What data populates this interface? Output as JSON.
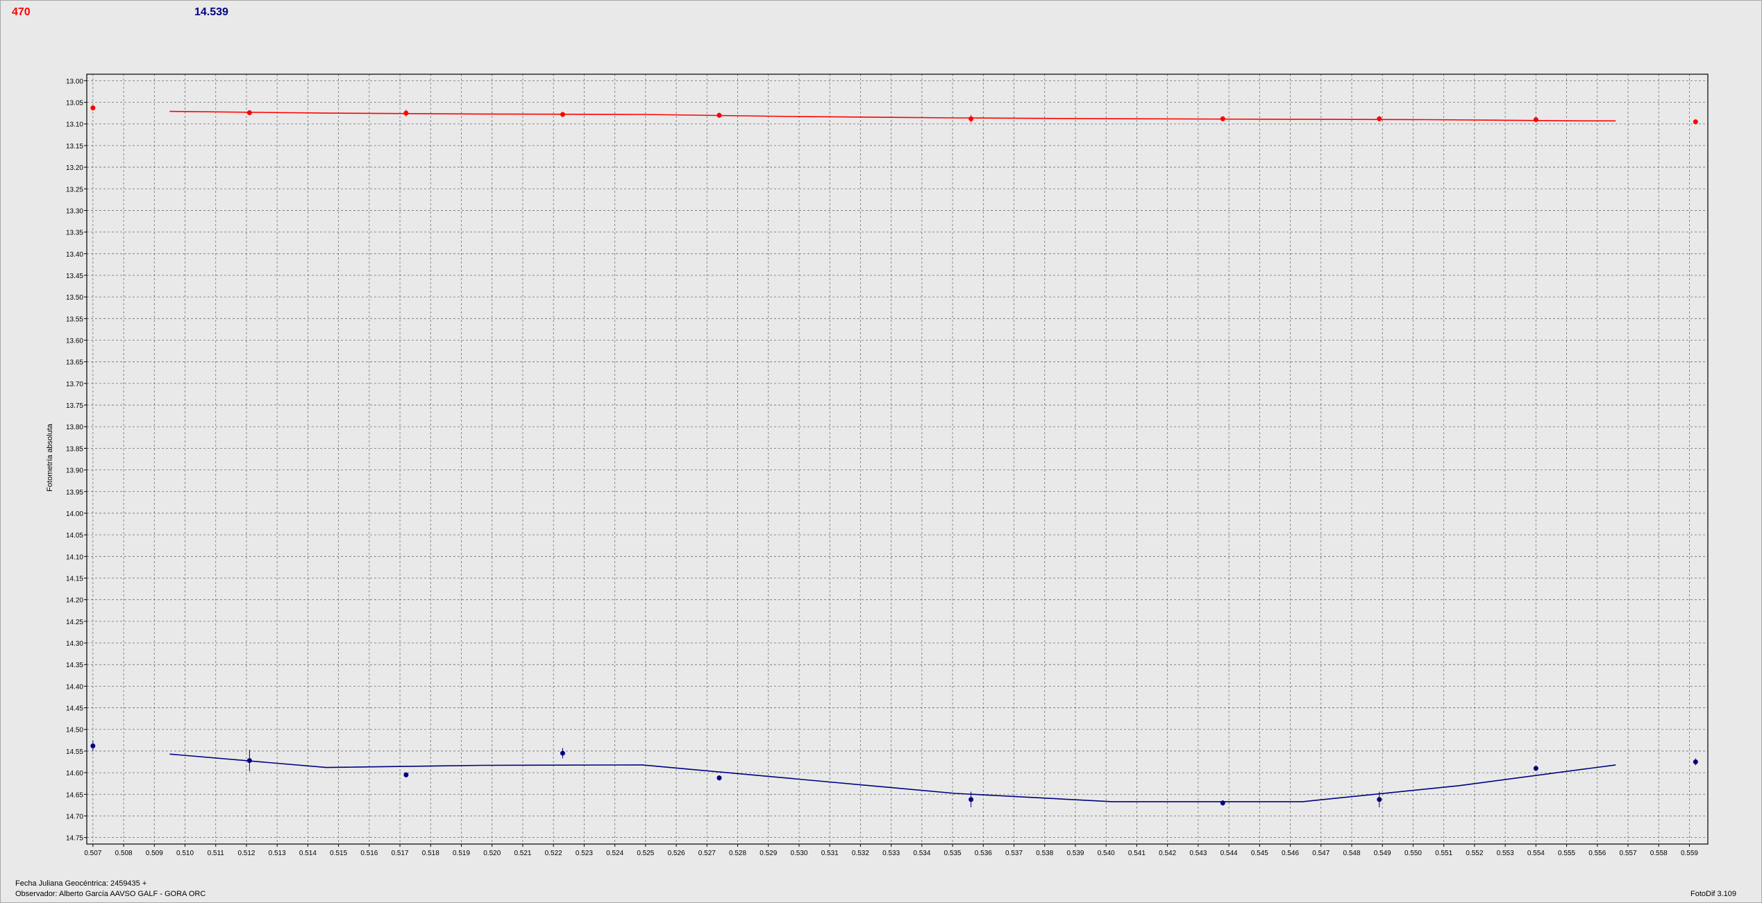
{
  "header": {
    "left_value": "470",
    "left_color": "#ff0000",
    "right_value": "14.539",
    "right_color": "#000080"
  },
  "footer": {
    "jd": "Fecha Juliana Geocéntrica: 2459435 +",
    "observer": "Observador: Alberto García AAVSO GALF - GORA ORC",
    "version": "FotoDif 3.109"
  },
  "chart_data": {
    "type": "scatter",
    "title": "",
    "xlabel": "",
    "ylabel": "Fotometría absoluta",
    "xlim": [
      0.5068,
      0.5596
    ],
    "ylim": [
      12.985,
      14.765
    ],
    "y_inverted": true,
    "grid": true,
    "x_ticks": [
      "0.507",
      "0.508",
      "0.509",
      "0.510",
      "0.511",
      "0.512",
      "0.513",
      "0.514",
      "0.515",
      "0.516",
      "0.517",
      "0.518",
      "0.519",
      "0.520",
      "0.521",
      "0.522",
      "0.523",
      "0.524",
      "0.525",
      "0.526",
      "0.527",
      "0.528",
      "0.529",
      "0.530",
      "0.531",
      "0.532",
      "0.533",
      "0.534",
      "0.535",
      "0.536",
      "0.537",
      "0.538",
      "0.539",
      "0.540",
      "0.541",
      "0.542",
      "0.543",
      "0.544",
      "0.545",
      "0.546",
      "0.547",
      "0.548",
      "0.549",
      "0.550",
      "0.551",
      "0.552",
      "0.553",
      "0.554",
      "0.555",
      "0.556",
      "0.557",
      "0.558",
      "0.559"
    ],
    "y_ticks": [
      "13.00",
      "13.05",
      "13.10",
      "13.15",
      "13.20",
      "13.25",
      "13.30",
      "13.35",
      "13.40",
      "13.45",
      "13.50",
      "13.55",
      "13.60",
      "13.65",
      "13.70",
      "13.75",
      "13.80",
      "13.85",
      "13.90",
      "13.95",
      "14.00",
      "14.05",
      "14.10",
      "14.15",
      "14.20",
      "14.25",
      "14.30",
      "14.35",
      "14.40",
      "14.45",
      "14.50",
      "14.55",
      "14.60",
      "14.65",
      "14.70",
      "14.75"
    ],
    "series": [
      {
        "color": "#ff0000",
        "points": [
          {
            "x": 0.507,
            "y": 13.063,
            "err": 0.006
          },
          {
            "x": 0.5121,
            "y": 13.074,
            "err": 0.006
          },
          {
            "x": 0.5172,
            "y": 13.075,
            "err": 0.008
          },
          {
            "x": 0.5223,
            "y": 13.078,
            "err": 0.006
          },
          {
            "x": 0.5274,
            "y": 13.08,
            "err": 0.006
          },
          {
            "x": 0.5356,
            "y": 13.088,
            "err": 0.009
          },
          {
            "x": 0.5438,
            "y": 13.088,
            "err": 0.006
          },
          {
            "x": 0.5489,
            "y": 13.088,
            "err": 0.006
          },
          {
            "x": 0.554,
            "y": 13.09,
            "err": 0.006
          },
          {
            "x": 0.5592,
            "y": 13.095,
            "err": 0.006
          }
        ],
        "fit": [
          {
            "x": 0.5095,
            "y": 13.071
          },
          {
            "x": 0.5146,
            "y": 13.075
          },
          {
            "x": 0.5197,
            "y": 13.077
          },
          {
            "x": 0.5249,
            "y": 13.078
          },
          {
            "x": 0.53,
            "y": 13.083
          },
          {
            "x": 0.5351,
            "y": 13.086
          },
          {
            "x": 0.5402,
            "y": 13.088
          },
          {
            "x": 0.5453,
            "y": 13.089
          },
          {
            "x": 0.5504,
            "y": 13.09
          },
          {
            "x": 0.5555,
            "y": 13.093
          },
          {
            "x": 0.5566,
            "y": 13.093
          }
        ]
      },
      {
        "color": "#000080",
        "points": [
          {
            "x": 0.507,
            "y": 14.538,
            "err": 0.012
          },
          {
            "x": 0.5121,
            "y": 14.572,
            "err": 0.025
          },
          {
            "x": 0.5172,
            "y": 14.605,
            "err": 0.006
          },
          {
            "x": 0.5223,
            "y": 14.555,
            "err": 0.012
          },
          {
            "x": 0.5274,
            "y": 14.612,
            "err": 0.006
          },
          {
            "x": 0.5356,
            "y": 14.662,
            "err": 0.018
          },
          {
            "x": 0.5438,
            "y": 14.67,
            "err": 0.006
          },
          {
            "x": 0.5489,
            "y": 14.662,
            "err": 0.018
          },
          {
            "x": 0.554,
            "y": 14.59,
            "err": 0.006
          },
          {
            "x": 0.5592,
            "y": 14.575,
            "err": 0.008
          }
        ],
        "fit": [
          {
            "x": 0.5095,
            "y": 14.557
          },
          {
            "x": 0.5146,
            "y": 14.588
          },
          {
            "x": 0.5197,
            "y": 14.583
          },
          {
            "x": 0.5249,
            "y": 14.582
          },
          {
            "x": 0.53,
            "y": 14.615
          },
          {
            "x": 0.5351,
            "y": 14.648
          },
          {
            "x": 0.5402,
            "y": 14.667
          },
          {
            "x": 0.5464,
            "y": 14.667
          },
          {
            "x": 0.5515,
            "y": 14.63
          },
          {
            "x": 0.5566,
            "y": 14.582
          }
        ]
      }
    ]
  }
}
